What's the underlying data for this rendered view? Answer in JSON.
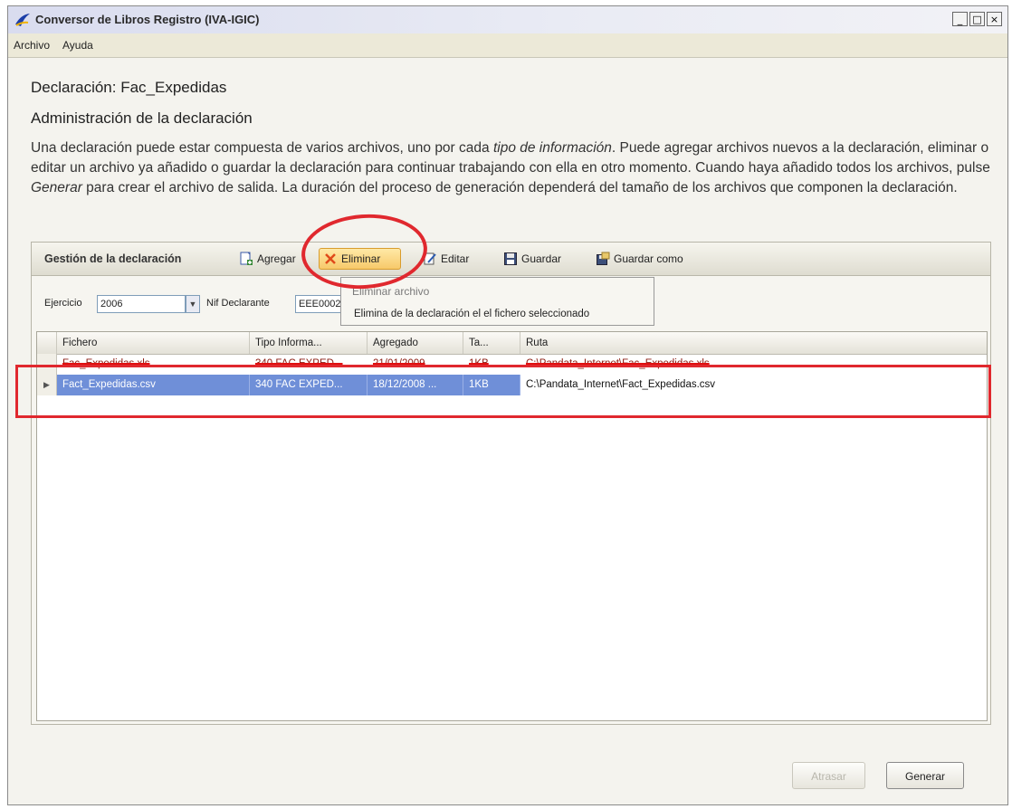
{
  "window": {
    "title": "Conversor de Libros Registro (IVA-IGIC)",
    "controls": [
      "_",
      "□",
      "×"
    ]
  },
  "menu": [
    "Archivo",
    "Ayuda"
  ],
  "header": {
    "declaration_title": "Declaración: Fac_Expedidas",
    "admin_title": "Administración de la declaración"
  },
  "description": {
    "p1": "Una declaración puede estar compuesta de varios archivos, uno por cada ",
    "p1_em": "tipo de información",
    "p2": ". Puede agregar archivos nuevos a la declaración, eliminar o editar un archivo ya añadido o guardar la declaración para continuar trabajando con ella en otro momento. Cuando haya añadido todos los archivos, pulse ",
    "p2_em": "Generar",
    "p3": " para crear el archivo de salida. La duración del proceso de generación dependerá del tamaño de los archivos que componen la declaración."
  },
  "toolbar": {
    "label": "Gestión de la declaración",
    "add": "Agregar",
    "delete": "Eliminar",
    "edit": "Editar",
    "save": "Guardar",
    "save_as": "Guardar como"
  },
  "filters": {
    "ejercicio_label": "Ejercicio",
    "ejercicio_value": "2006",
    "nif_label": "Nif Declarante",
    "nif_value": "EEE0002"
  },
  "tooltip": {
    "title": "Eliminar archivo",
    "body": "Elimina de la declaración el el fichero seleccionado"
  },
  "grid": {
    "columns": [
      "Fichero",
      "Tipo Informa...",
      "Agregado",
      "Ta...",
      "Ruta"
    ],
    "rows": [
      {
        "fichero": "Fac_Expedidas.xls",
        "tipo": "340 FAC EXPED...",
        "agregado": "21/01/2009",
        "tamano": "1KB",
        "ruta": "C:\\Pandata_Internet\\Fac_Expedidas.xls",
        "state": "deleted"
      },
      {
        "fichero": "Fact_Expedidas.csv",
        "tipo": "340 FAC EXPED...",
        "agregado": "18/12/2008 ...",
        "tamano": "1KB",
        "ruta": "C:\\Pandata_Internet\\Fact_Expedidas.csv",
        "state": "selected"
      }
    ]
  },
  "footer": {
    "back": "Atrasar",
    "generate": "Generar"
  },
  "colors": {
    "highlight_red": "#e0282e",
    "selection_blue": "#6f8fd8",
    "active_button": "#f7c96a"
  },
  "icons": [
    "app-icon",
    "add-document-icon",
    "delete-x-icon",
    "edit-icon",
    "save-icon",
    "save-as-icon",
    "dropdown-arrow-icon",
    "row-pointer-icon"
  ]
}
